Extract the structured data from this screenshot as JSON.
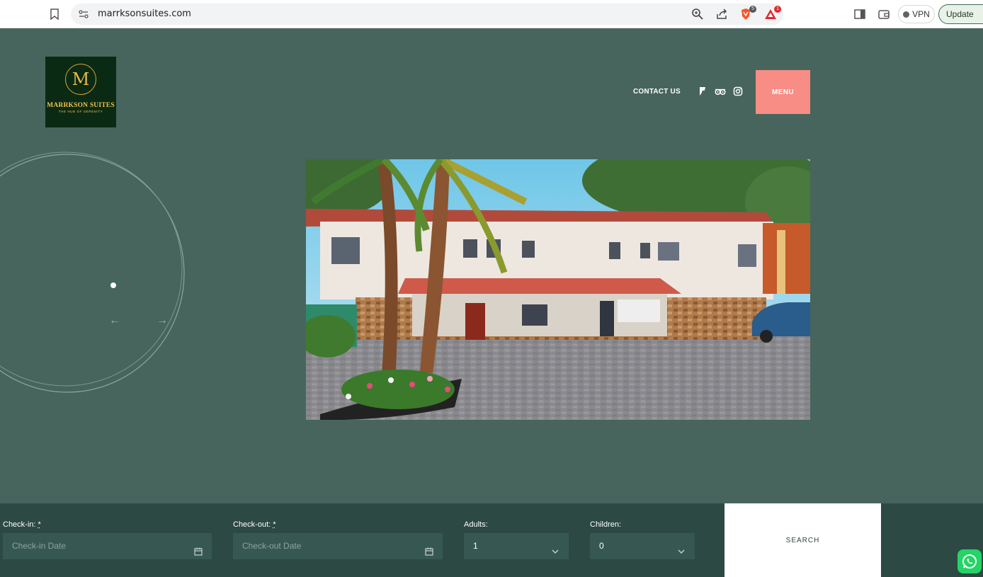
{
  "browser": {
    "url": "marrksonsuites.com",
    "vpn_label": "VPN",
    "update_label": "Update",
    "brave_badge_count": "5",
    "rewards_badge_count": "1"
  },
  "site": {
    "logo": {
      "monogram": "M",
      "brand": "MARRKSON SUITES",
      "tagline": "THE HUB OF SERENITY"
    },
    "nav": {
      "contact": "CONTACT US",
      "menu": "MENU"
    },
    "social_icons": [
      "foursquare-icon",
      "tripadvisor-icon",
      "instagram-icon"
    ],
    "slider": {
      "prev_arrow": "←",
      "next_arrow": "→"
    }
  },
  "booking": {
    "checkin": {
      "label": "Check-in:",
      "required_mark": "*",
      "placeholder": "Check-in Date"
    },
    "checkout": {
      "label": "Check-out:",
      "required_mark": "*",
      "placeholder": "Check-out Date"
    },
    "adults": {
      "label": "Adults:",
      "value": "1"
    },
    "children": {
      "label": "Children:",
      "value": "0"
    },
    "search": "SEARCH"
  },
  "colors": {
    "page_bg": "#47655c",
    "booking_bg": "#2c4943",
    "menu_accent": "#f78d84",
    "whatsapp": "#25d366"
  }
}
